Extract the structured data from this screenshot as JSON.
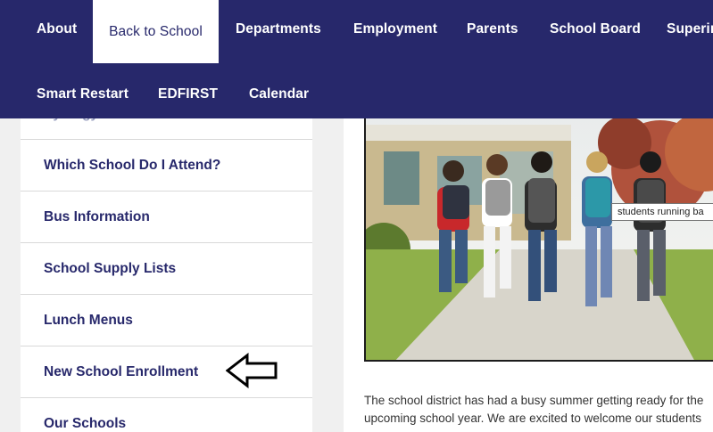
{
  "nav": {
    "row1": [
      "About",
      "Back to School",
      "Departments",
      "Employment",
      "Parents",
      "School Board",
      "Superin"
    ],
    "row2": [
      "Smart Restart",
      "EDFIRST",
      "Calendar"
    ],
    "active": "Back to School"
  },
  "sidebar": {
    "items": [
      "Synergy Information",
      "Which School Do I Attend?",
      "Bus Information",
      "School Supply Lists",
      "Lunch Menus",
      "New School Enrollment",
      "Our Schools"
    ]
  },
  "photo": {
    "tooltip": "students running ba"
  },
  "content": {
    "line1": "The school district has had a busy summer getting ready for the",
    "line2": "upcoming school year.  We are excited to welcome our students"
  },
  "colors": {
    "nav_bg": "#27286b",
    "link": "#27286b",
    "sidebar_bg": "#f0f0f0"
  }
}
